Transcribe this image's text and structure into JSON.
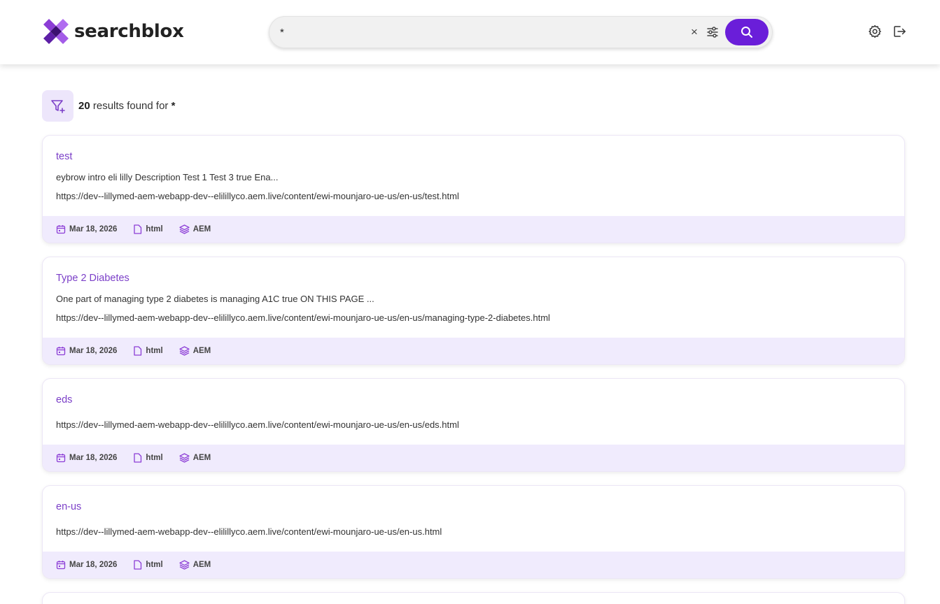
{
  "brand": {
    "name": "searchblox"
  },
  "search": {
    "query": "*",
    "placeholder": ""
  },
  "results_summary": {
    "count": "20",
    "text": " results found for ",
    "query": "*"
  },
  "results": [
    {
      "title": "test",
      "description": "eybrow intro eli lilly Description Test 1 Test 3 true Ena...",
      "url": "https://dev--lillymed-aem-webapp-dev--elililly​co.aem.live/content/ewi-mounjaro-ue-us/en-us/test.html",
      "date": "Mar 18, 2026",
      "type": "html",
      "source": "AEM"
    },
    {
      "title": "Type 2 Diabetes",
      "description": "One part of managing type 2 diabetes is managing A1C true ON THIS PAGE ...",
      "url": "https://dev--lillymed-aem-webapp-dev--elilillyco.aem.live/content/ewi-mounjaro-ue-us/en-us/managing-type-2-diabetes.html",
      "date": "Mar 18, 2026",
      "type": "html",
      "source": "AEM"
    },
    {
      "title": "eds",
      "description": "",
      "url": "https://dev--lillymed-aem-webapp-dev--elilillyco.aem.live/content/ewi-mounjaro-ue-us/en-us/eds.html",
      "date": "Mar 18, 2026",
      "type": "html",
      "source": "AEM"
    },
    {
      "title": "en-us",
      "description": "",
      "url": "https://dev--lillymed-aem-webapp-dev--elilillyco.aem.live/content/ewi-mounjaro-ue-us/en-us.html",
      "date": "Mar 18, 2026",
      "type": "html",
      "source": "AEM"
    }
  ],
  "colors": {
    "accent": "#6a1ed9",
    "title_link": "#7b3fc8",
    "meta_bg": "#f0ebfd"
  },
  "icons": [
    "search-icon",
    "clear-icon",
    "filter-settings-icon",
    "settings-icon",
    "logout-icon",
    "filter-icon",
    "calendar-icon",
    "file-icon",
    "layers-icon"
  ]
}
